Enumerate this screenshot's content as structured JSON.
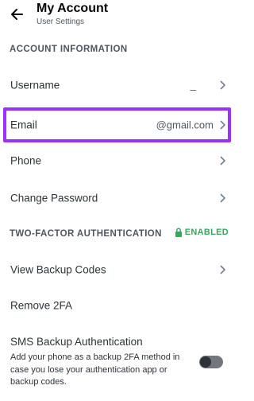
{
  "header": {
    "back_icon": "arrow-left-icon",
    "title": "My Account",
    "subtitle": "User Settings"
  },
  "account_section": {
    "heading": "ACCOUNT INFORMATION",
    "rows": [
      {
        "label": "Username",
        "value": "_"
      },
      {
        "label": "Email",
        "value": "@gmail.com"
      },
      {
        "label": "Phone",
        "value": ""
      },
      {
        "label": "Change Password",
        "value": ""
      }
    ]
  },
  "twofa_section": {
    "heading": "TWO-FACTOR AUTHENTICATION",
    "status": "ENABLED",
    "status_icon": "lock-icon",
    "status_color": "#3ba55d",
    "rows": [
      {
        "label": "View Backup Codes"
      },
      {
        "label": "Remove 2FA"
      }
    ],
    "sms": {
      "label": "SMS Backup Authentication",
      "description": "Add your phone as a backup 2FA method in case you lose your authentication app or backup codes.",
      "toggle_on": false
    }
  },
  "highlight_color": "#9b30ff"
}
